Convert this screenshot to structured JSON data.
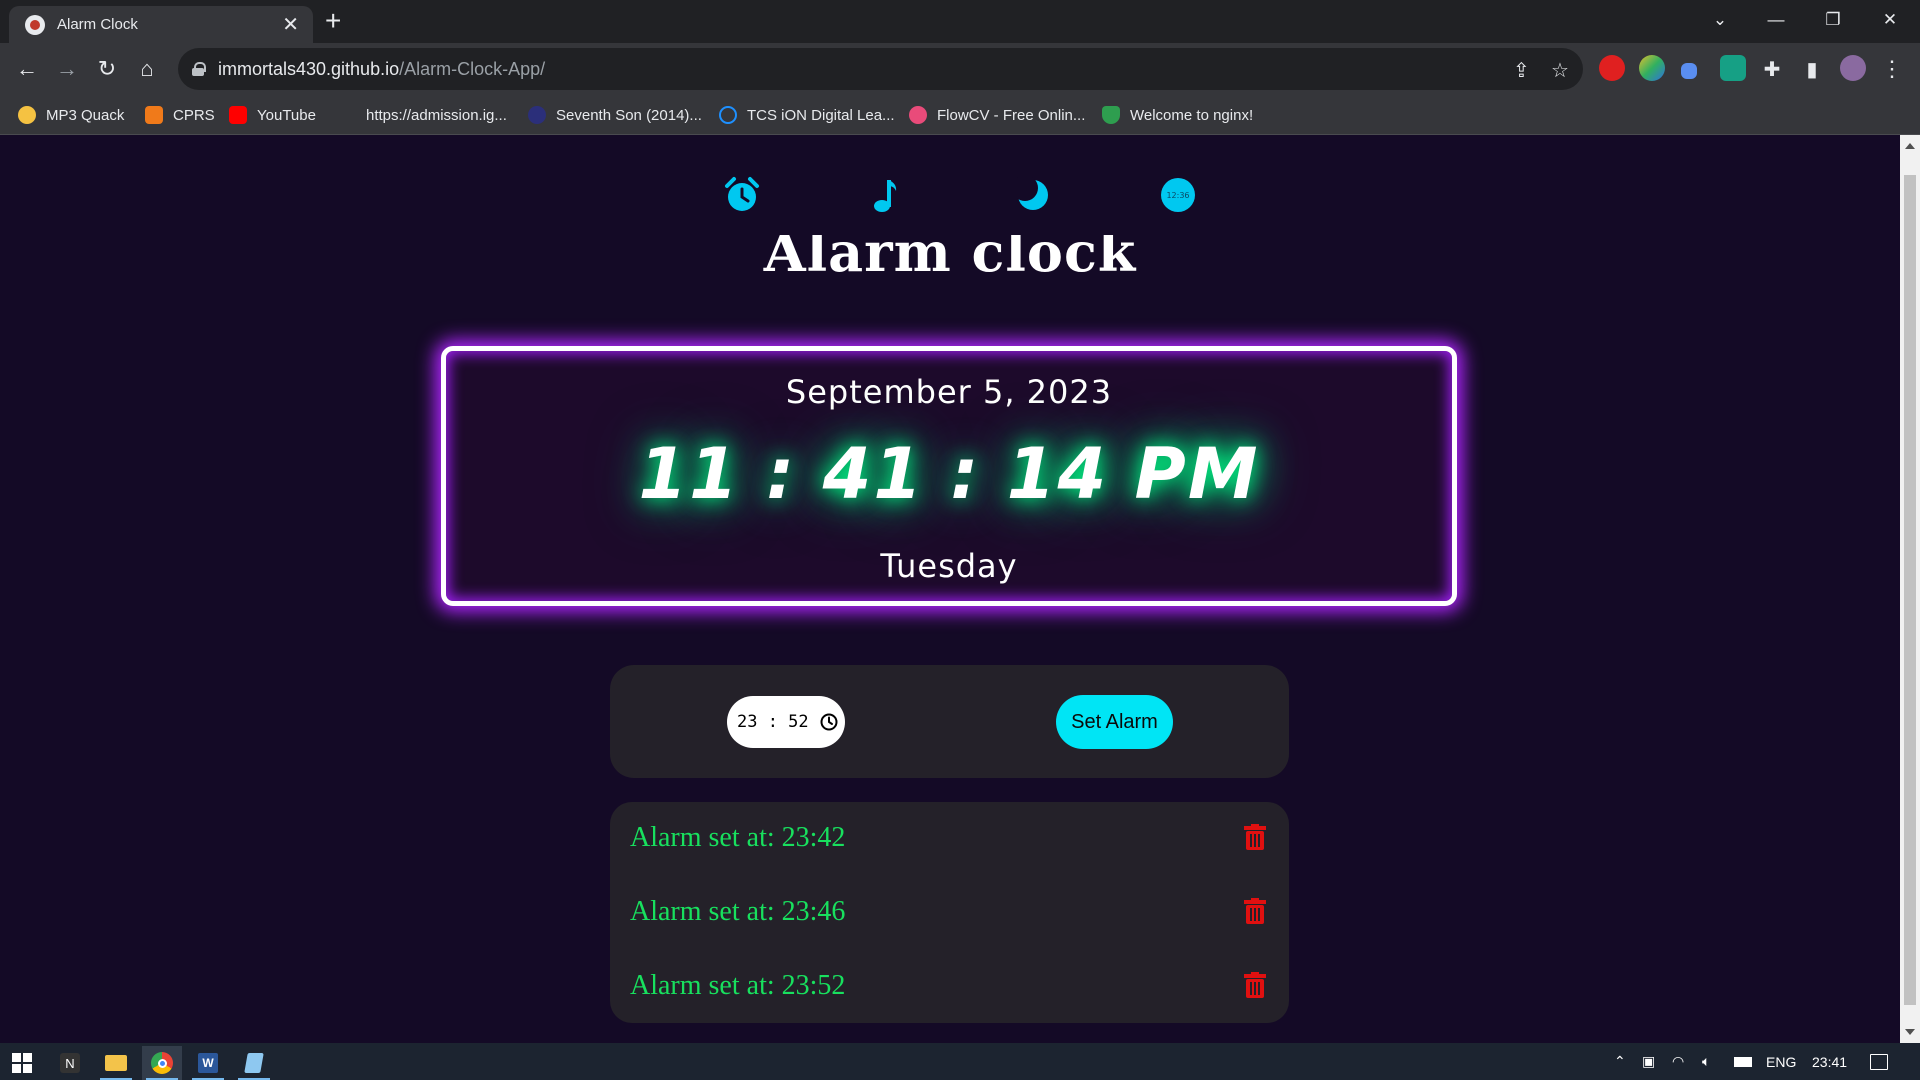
{
  "browser": {
    "tab_title": "Alarm Clock",
    "url_host": "immortals430.github.io",
    "url_path": "/Alarm-Clock-App/",
    "bookmarks": [
      {
        "label": "MP3 Quack",
        "icon": "duck-icon",
        "color": "#f5c242"
      },
      {
        "label": "CPRS",
        "icon": "cprs-icon",
        "color": "#f07a1a"
      },
      {
        "label": "YouTube",
        "icon": "youtube-icon",
        "color": "#ff0000"
      },
      {
        "label": "https://admission.ig...",
        "icon": "blank-page-icon",
        "color": "#35363a"
      },
      {
        "label": "Seventh Son (2014)...",
        "icon": "movie-icon",
        "color": "#2b2f7a"
      },
      {
        "label": "TCS iON Digital Lea...",
        "icon": "power-icon",
        "color": "#1e90ff"
      },
      {
        "label": "FlowCV - Free Onlin...",
        "icon": "flowcv-icon",
        "color": "#e94b7a"
      },
      {
        "label": "Welcome to nginx!",
        "icon": "shield-icon",
        "color": "#2e9e4f"
      }
    ]
  },
  "app": {
    "heading": "Alarm clock",
    "nav_icons": [
      "alarm-icon",
      "music-note-icon",
      "moon-icon",
      "mini-clock-icon"
    ],
    "mini_clock_label": "12:36",
    "date": "September 5, 2023",
    "time": "11 : 41 : 14 PM",
    "day": "Tuesday",
    "alarm_input_value": "23 : 52",
    "set_alarm_label": "Set Alarm",
    "alarms": [
      {
        "label": "Alarm set at: 23:42"
      },
      {
        "label": "Alarm set at: 23:46"
      },
      {
        "label": "Alarm set at: 23:52"
      }
    ],
    "colors": {
      "accent": "#00e5f5",
      "alarm_text": "#18e05e",
      "delete": "#e01010",
      "glow": "#b026ff",
      "background": "#140a26"
    }
  },
  "taskbar": {
    "language": "ENG",
    "clock": "23:41"
  }
}
